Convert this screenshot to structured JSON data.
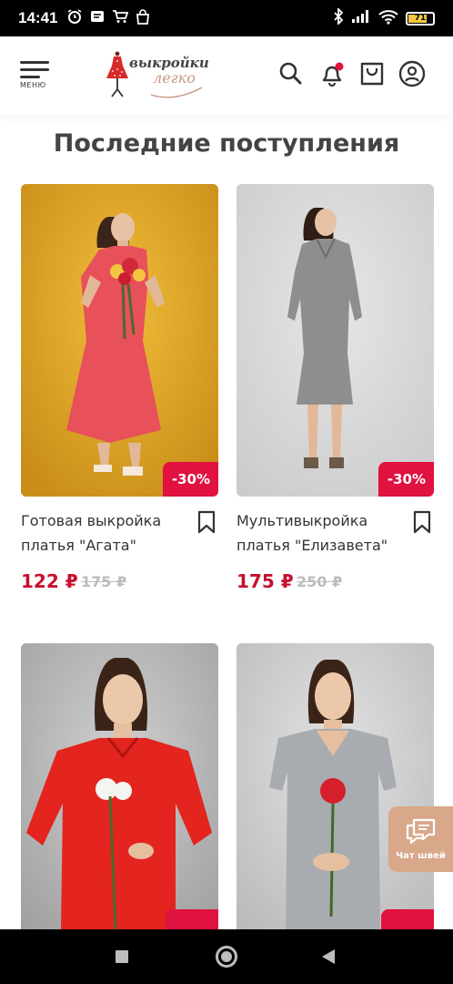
{
  "status_bar": {
    "time": "14:41",
    "battery_level": "71",
    "icons": [
      "alarm-icon",
      "message-icon",
      "cart-notification-icon",
      "bag-notification-icon",
      "bluetooth-icon",
      "signal-icon",
      "wifi-icon",
      "battery-icon"
    ]
  },
  "header": {
    "menu_label": "МЕНЮ",
    "logo_line1": "выкройки",
    "logo_line2": "легко",
    "icons": [
      "search-icon",
      "bell-icon",
      "bag-icon",
      "user-icon"
    ],
    "notification_dot_color": "#e0123f"
  },
  "section": {
    "title": "Последние поступления"
  },
  "products": [
    {
      "name": "Готовая выкройка платья \"Агата\"",
      "discount": "-30%",
      "price": "122 ₽",
      "old_price": "175 ₽",
      "image_bg": "#e2a928",
      "dress_color": "#e8505a"
    },
    {
      "name": "Мультивыкройка платья \"Елизавета\"",
      "discount": "-30%",
      "price": "175 ₽",
      "old_price": "250 ₽",
      "image_bg": "#d9d9d9",
      "dress_color": "#8f8f8f"
    },
    {
      "name": "",
      "discount": "",
      "price": "",
      "old_price": "",
      "image_bg": "#bcbcbc",
      "dress_color": "#e3241f"
    },
    {
      "name": "",
      "discount": "",
      "price": "",
      "old_price": "",
      "image_bg": "#d2d2d2",
      "dress_color": "#a8acb0"
    }
  ],
  "chat": {
    "label": "Чат швей",
    "color": "#d9a78a"
  },
  "nav": {
    "buttons": [
      "recent-apps-button",
      "home-button",
      "back-button"
    ]
  },
  "colors": {
    "accent": "#c8102e",
    "badge": "#e0123f"
  }
}
